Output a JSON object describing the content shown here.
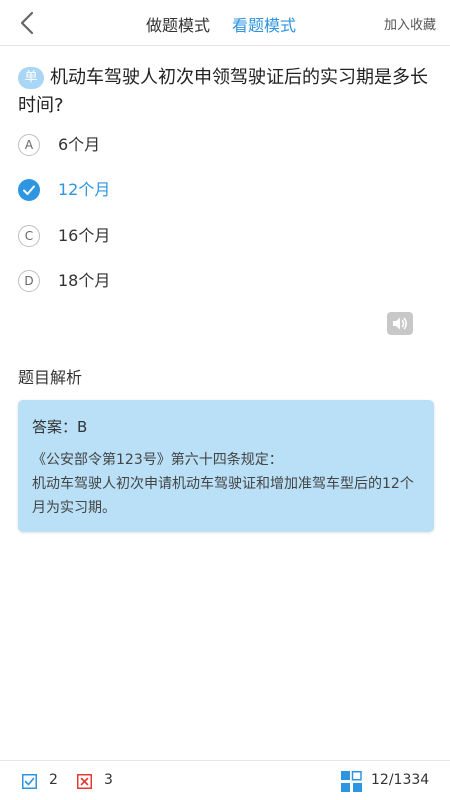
{
  "header": {
    "mode_practice": "做题模式",
    "mode_view": "看题模式",
    "favorite": "加入收藏"
  },
  "question": {
    "type_badge": "单",
    "text": "机动车驾驶人初次申领驾驶证后的实习期是多长时间?"
  },
  "options": [
    {
      "letter": "A",
      "text": "6个月",
      "selected": false
    },
    {
      "letter": "B",
      "text": "12个月",
      "selected": true
    },
    {
      "letter": "C",
      "text": "16个月",
      "selected": false
    },
    {
      "letter": "D",
      "text": "18个月",
      "selected": false
    }
  ],
  "analysis": {
    "title": "题目解析",
    "answer": "答案：B",
    "explanation_line1": "《公安部令第123号》第六十四条规定：",
    "explanation_line2": "机动车驾驶人初次申请机动车驾驶证和增加准驾车型后的12个月为实习期。"
  },
  "footer": {
    "right_count": "2",
    "wrong_count": "3",
    "progress": "12/1334"
  },
  "colors": {
    "accent": "#2e95e0",
    "analysis_bg": "#b9e0f6",
    "wrong": "#e53935"
  },
  "icons": {
    "back": "chevron-left-icon",
    "check": "check-circle-icon",
    "speaker": "speaker-icon",
    "right": "checkbox-check-icon",
    "wrong": "checkbox-x-icon",
    "grid": "grid-icon"
  }
}
